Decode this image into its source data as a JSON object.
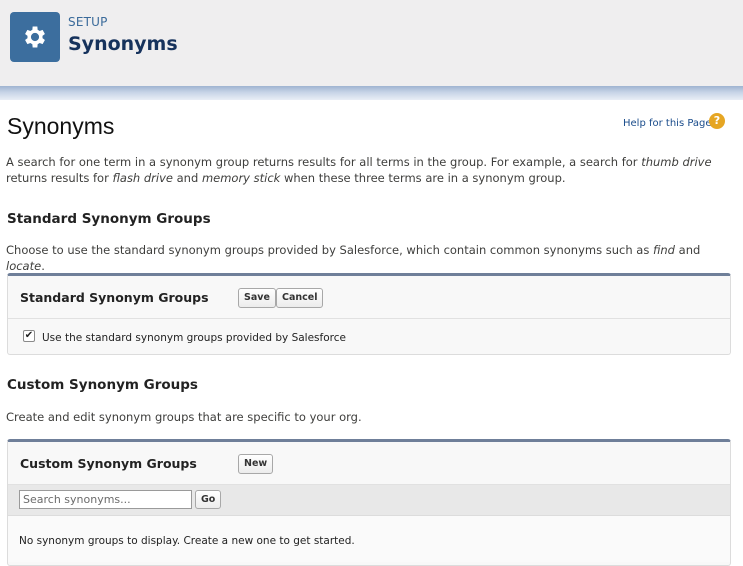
{
  "header": {
    "eyebrow": "SETUP",
    "title": "Synonyms",
    "icon": "gear-icon",
    "icon_bg": "#3c6e9e"
  },
  "page": {
    "title": "Synonyms",
    "help_link": "Help for this Page",
    "help_icon": "?",
    "description": {
      "t1": "A search for one term in a synonym group returns results for all terms in the group. For example, a search for ",
      "e1": "thumb drive",
      "t2": " returns results for ",
      "e2": "flash drive",
      "t3": " and ",
      "e3": "memory stick",
      "t4": " when these three terms are in a synonym group."
    }
  },
  "standard": {
    "heading": "Standard Synonym Groups",
    "desc": {
      "t1": "Choose to use the standard synonym groups provided by Salesforce, which contain common synonyms such as ",
      "e1": "find",
      "t2": " and ",
      "e2": "locate",
      "t3": "."
    },
    "panel_title": "Standard Synonym Groups",
    "save_label": "Save",
    "cancel_label": "Cancel",
    "checkbox_checked": true,
    "checkbox_mark": "✔",
    "checkbox_label": "Use the standard synonym groups provided by Salesforce"
  },
  "custom": {
    "heading": "Custom Synonym Groups",
    "desc": "Create and edit synonym groups that are specific to your org.",
    "panel_title": "Custom Synonym Groups",
    "new_label": "New",
    "search_placeholder": "Search synonyms...",
    "search_value": "",
    "go_label": "Go",
    "empty_text": "No synonym groups to display. Create a new one to get started."
  }
}
